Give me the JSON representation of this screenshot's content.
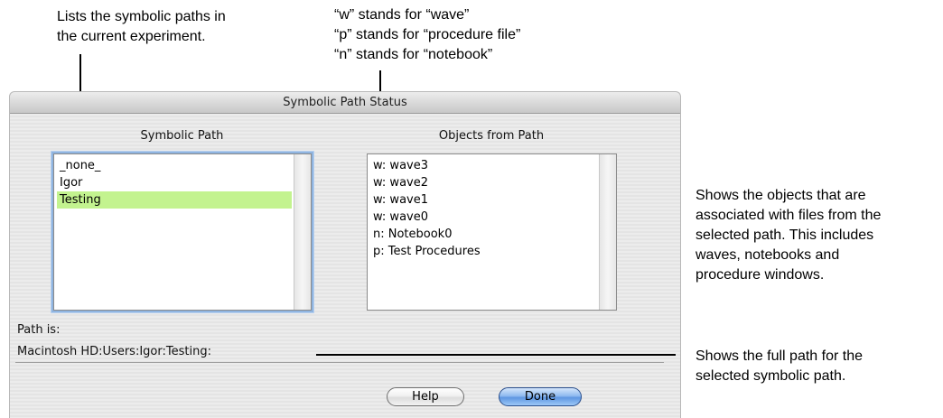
{
  "annotations": {
    "symbolic_paths_note": [
      "Lists the symbolic paths in",
      "the current experiment."
    ],
    "prefix_legend": [
      "“w” stands for “wave”",
      "“p” stands for “procedure file”",
      "“n” stands for “notebook”"
    ],
    "objects_note": [
      "Shows the objects that are",
      "associated with files from the",
      "selected path. This includes",
      "waves, notebooks and",
      "procedure windows."
    ],
    "full_path_note": [
      "Shows the full path for the",
      "selected symbolic path."
    ]
  },
  "dialog": {
    "title": "Symbolic Path Status",
    "symbolic_path": {
      "header": "Symbolic Path",
      "items": [
        "_none_",
        "Igor",
        "Testing"
      ],
      "selected": "Testing"
    },
    "objects": {
      "header": "Objects from Path",
      "items": [
        "w: wave3",
        "w: wave2",
        "w: wave1",
        "w: wave0",
        "n: Notebook0",
        "p: Test Procedures"
      ]
    },
    "path_label": "Path is:",
    "path_value": "Macintosh HD:Users:Igor:Testing:",
    "buttons": {
      "help": "Help",
      "done": "Done"
    }
  }
}
